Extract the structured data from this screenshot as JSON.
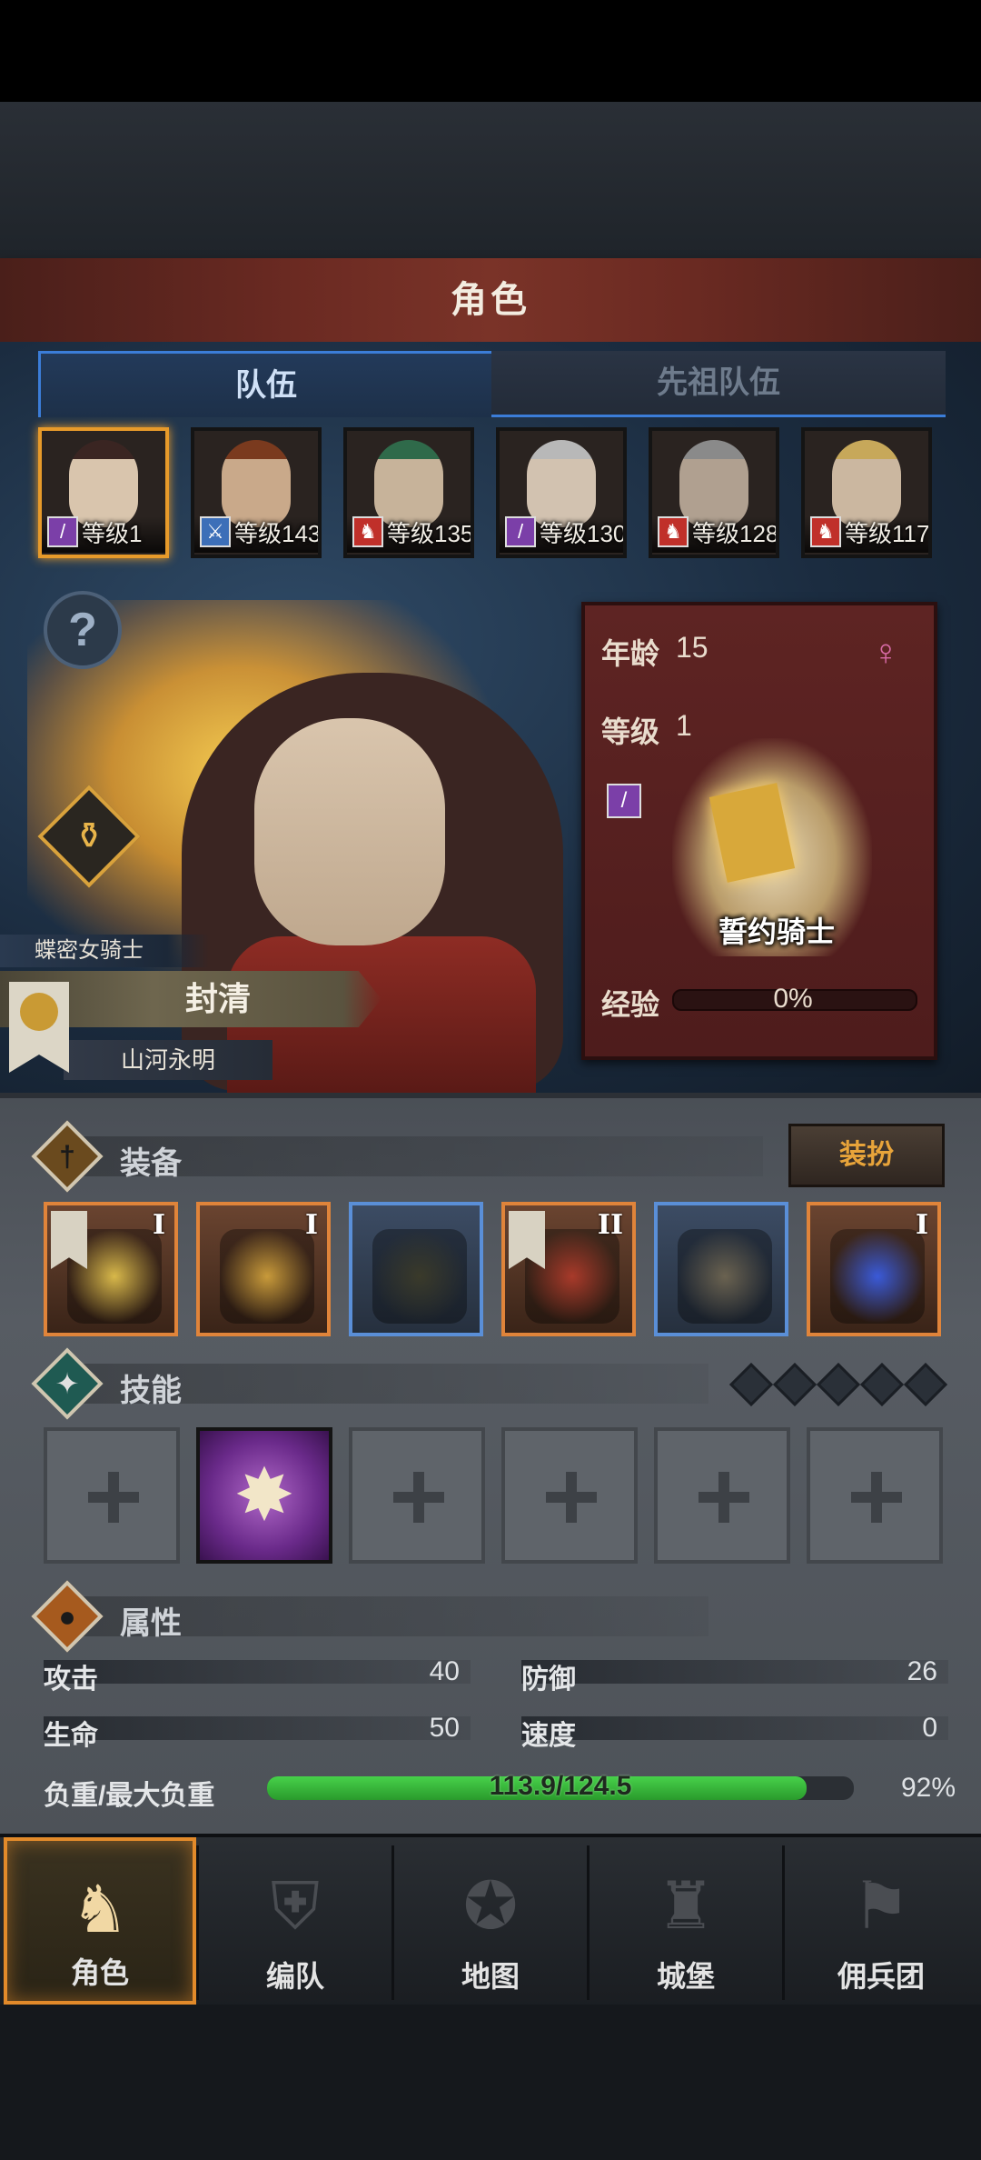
{
  "title": "角色",
  "tabs": [
    {
      "label": "队伍",
      "active": true
    },
    {
      "label": "先祖队伍",
      "active": false
    }
  ],
  "roster": [
    {
      "level": "等级1",
      "class_icon": "staff-icon",
      "class_color": "#7b3fa8",
      "hair": "#3a2522",
      "skin": "#d9c5ad",
      "active": true
    },
    {
      "level": "等级143",
      "class_icon": "sword-icon",
      "class_color": "#3d6fb8",
      "hair": "#7a3a1e",
      "skin": "#c9a98a",
      "active": false
    },
    {
      "level": "等级135",
      "class_icon": "horse-star-icon",
      "class_color": "#c0302a",
      "hair": "#2f6a4a",
      "skin": "#c7b39a",
      "active": false
    },
    {
      "level": "等级130",
      "class_icon": "staff-star-icon",
      "class_color": "#7b3fa8",
      "hair": "#b8b8b8",
      "skin": "#d2c2b0",
      "active": false
    },
    {
      "level": "等级128",
      "class_icon": "horse-star-icon",
      "class_color": "#c0302a",
      "hair": "#8a8a8a",
      "skin": "#b0a090",
      "active": false
    },
    {
      "level": "等级117",
      "class_icon": "horse-icon",
      "class_color": "#c0302a",
      "hair": "#c7a85a",
      "skin": "#cbb7a0",
      "active": false
    }
  ],
  "hero": {
    "class_label": "蝶密女骑士",
    "name": "封清",
    "title": "山河永明"
  },
  "info": {
    "age_label": "年龄",
    "age": "15",
    "gender_icon": "female-icon",
    "level_label": "等级",
    "level": "1",
    "mount_name": "誓约骑士",
    "exp_label": "经验",
    "exp_text": "0%",
    "exp_fraction": 0
  },
  "equipment": {
    "title": "装备",
    "dress_button": "装扮",
    "items": [
      {
        "name": "golden-blade",
        "tier": "I",
        "rarity": "orange",
        "flag": true,
        "art_color": "#d8b84a"
      },
      {
        "name": "ornate-shield",
        "tier": "I",
        "rarity": "orange",
        "flag": false,
        "art_color": "#c89a3a"
      },
      {
        "name": "dark-hood",
        "tier": "",
        "rarity": "blue",
        "flag": false,
        "art_color": "#3a3a2a"
      },
      {
        "name": "crimson-armor",
        "tier": "II",
        "rarity": "orange",
        "flag": true,
        "art_color": "#a83a2a"
      },
      {
        "name": "wrapped-boots",
        "tier": "",
        "rarity": "blue",
        "flag": false,
        "art_color": "#6a6250"
      },
      {
        "name": "arcane-orb",
        "tier": "I",
        "rarity": "orange",
        "flag": false,
        "art_color": "#3a5ad8"
      }
    ]
  },
  "skills": {
    "title": "技能",
    "slots": [
      {
        "state": "empty"
      },
      {
        "state": "filled",
        "glyph": "✸"
      },
      {
        "state": "empty"
      },
      {
        "state": "empty"
      },
      {
        "state": "empty"
      },
      {
        "state": "empty"
      }
    ],
    "diamond_count": 5
  },
  "attributes": {
    "title": "属性",
    "attack_label": "攻击",
    "attack": "40",
    "defense_label": "防御",
    "defense": "26",
    "hp_label": "生命",
    "hp": "50",
    "speed_label": "速度",
    "speed": "0",
    "weight_label": "负重/最大负重",
    "weight_text": "113.9/124.5",
    "weight_percent": "92%",
    "weight_fraction": 0.92
  },
  "nav": [
    {
      "label": "角色",
      "icon": "knight-icon",
      "glyph": "♞",
      "active": true
    },
    {
      "label": "编队",
      "icon": "helmet-icon",
      "glyph": "⛨",
      "active": false
    },
    {
      "label": "地图",
      "icon": "compass-icon",
      "glyph": "✪",
      "active": false
    },
    {
      "label": "城堡",
      "icon": "castle-icon",
      "glyph": "♜",
      "active": false
    },
    {
      "label": "佣兵团",
      "icon": "banner-icon",
      "glyph": "⚑",
      "active": false
    }
  ]
}
